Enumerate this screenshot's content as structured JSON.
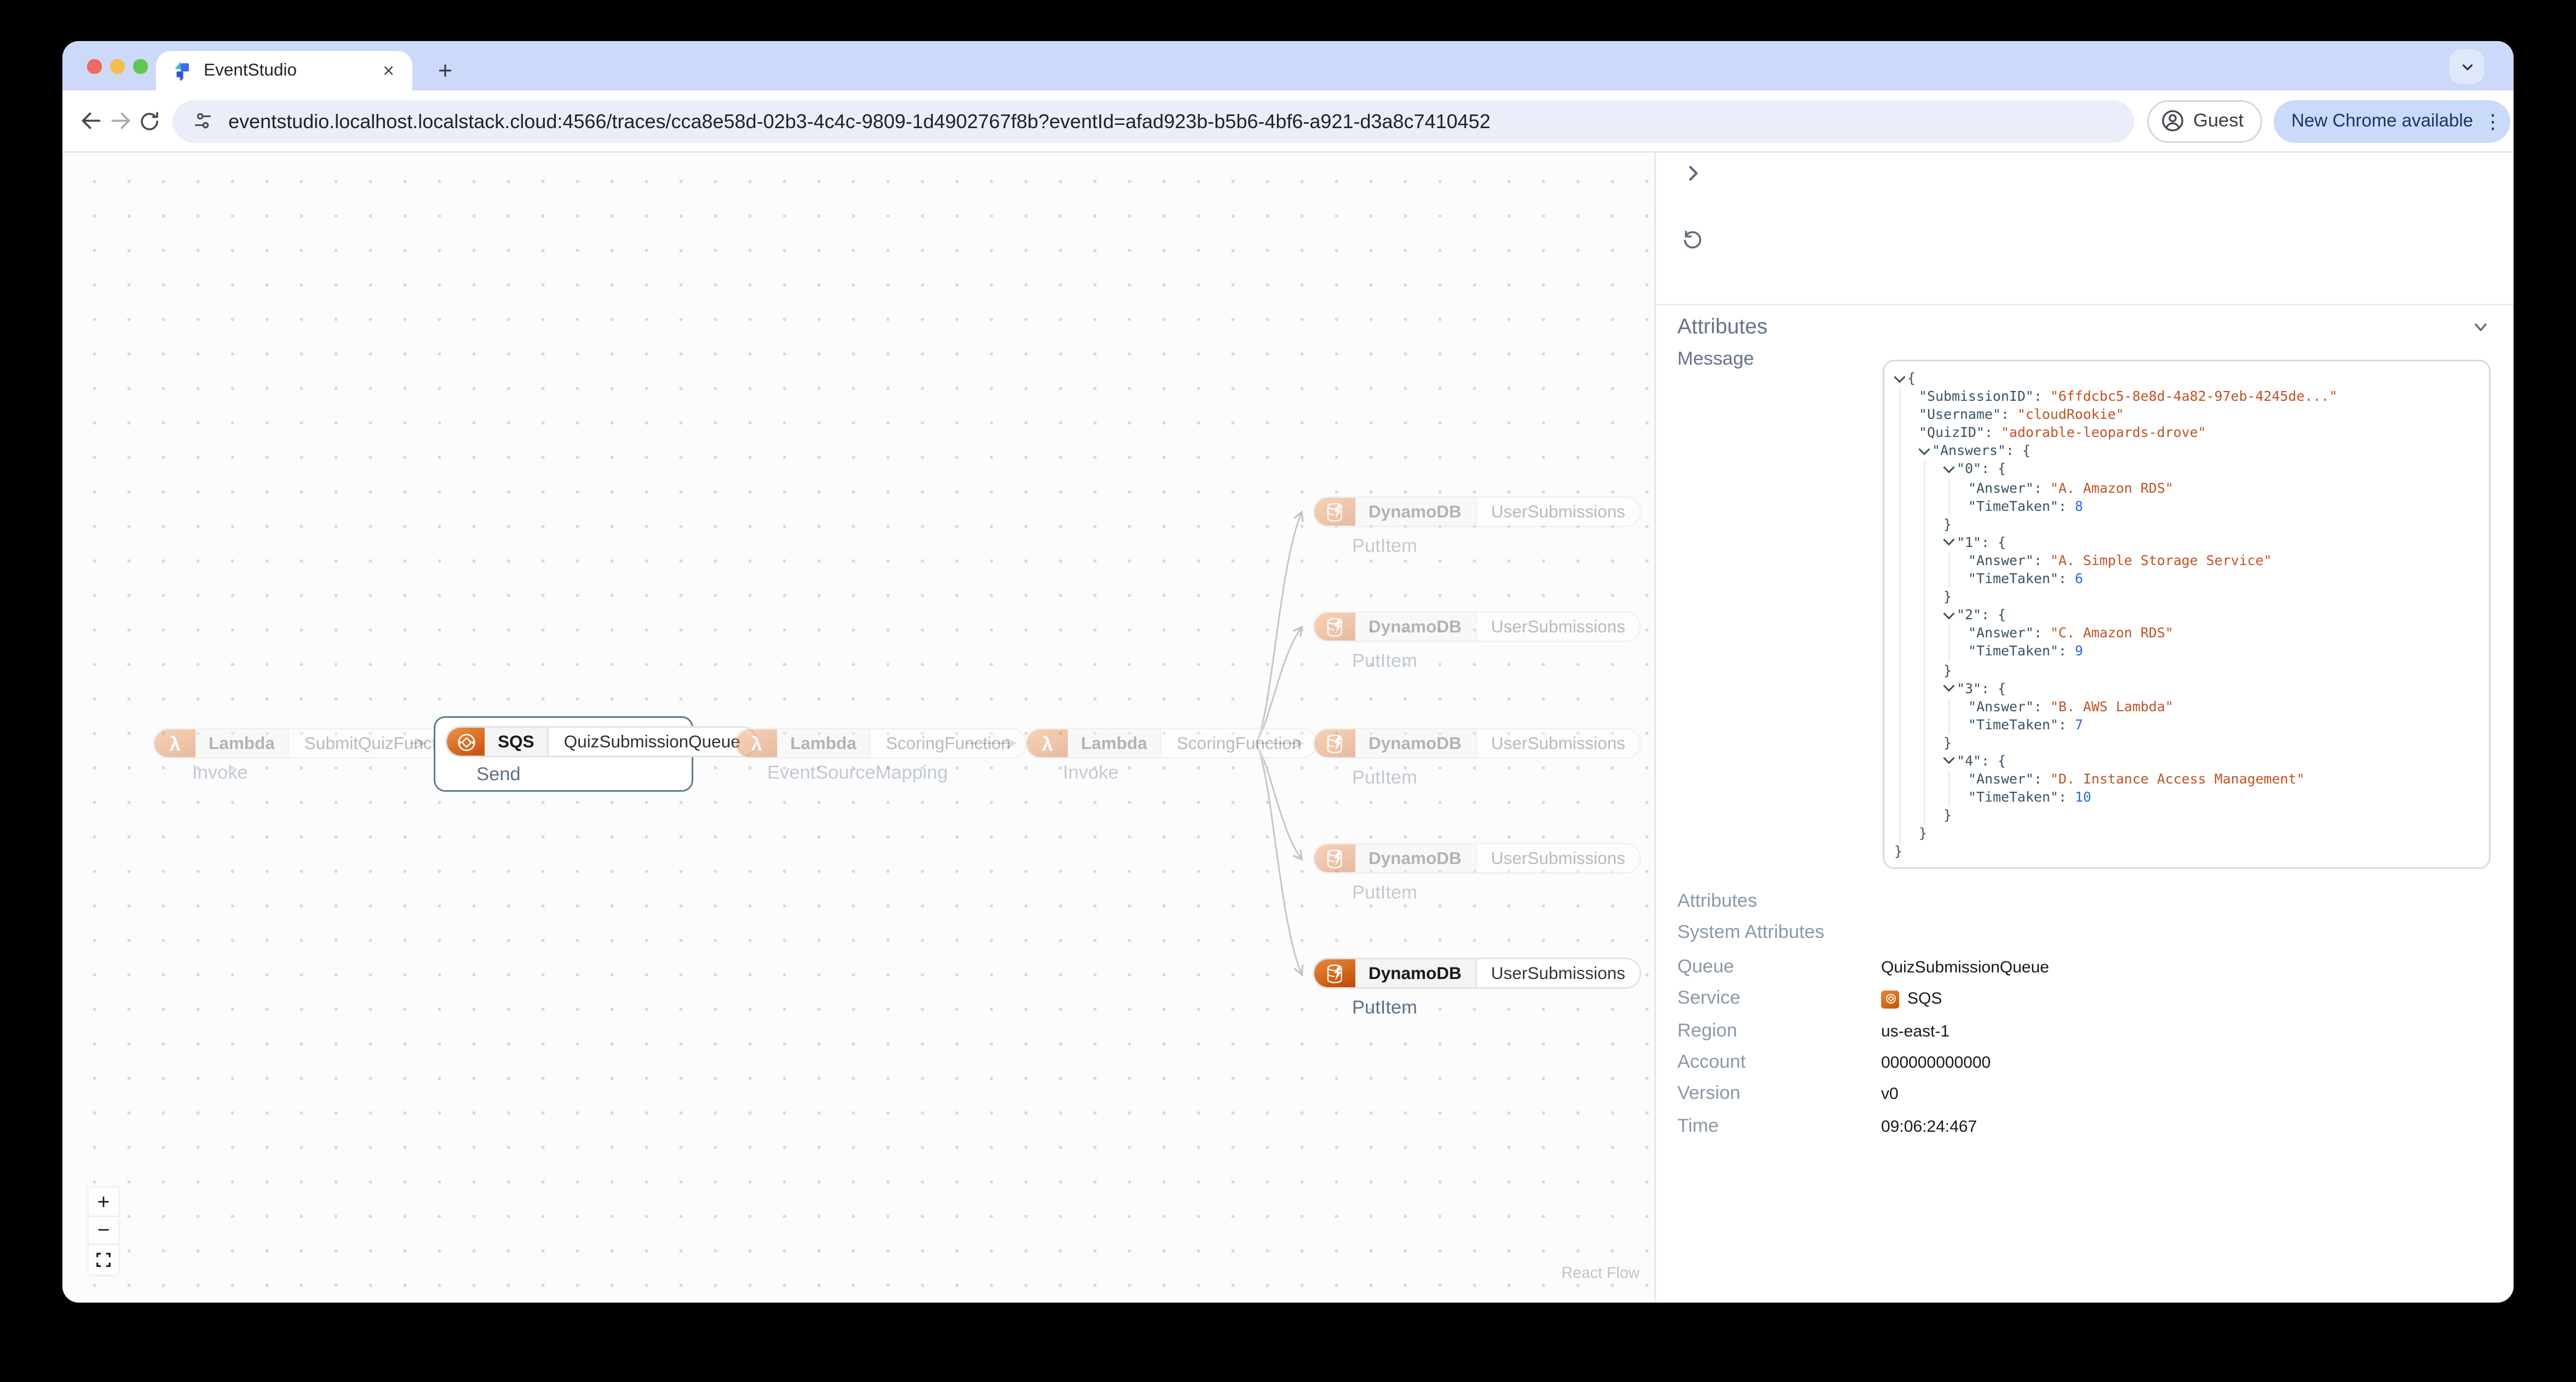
{
  "browser": {
    "tab_title": "EventStudio",
    "url": "eventstudio.localhost.localstack.cloud:4566/traces/cca8e58d-02b3-4c4c-9809-1d4902767f8b?eventId=afad923b-b5b6-4bf6-a921-d3a8c7410452",
    "guest_label": "Guest",
    "update_label": "New Chrome available",
    "new_tab_glyph": "+",
    "close_tab_glyph": "×",
    "kebab_glyph": "⋮"
  },
  "canvas": {
    "nodes": {
      "lambda_submit": {
        "service": "Lambda",
        "name": "SubmitQuizFunction",
        "operation": "Invoke"
      },
      "sqs_queue": {
        "service": "SQS",
        "name": "QuizSubmissionQueue",
        "operation": "Send",
        "selected": true
      },
      "lambda_scoring_esm": {
        "service": "Lambda",
        "name": "ScoringFunction",
        "operation": "EventSourceMapping"
      },
      "lambda_scoring_invoke": {
        "service": "Lambda",
        "name": "ScoringFunction",
        "operation": "Invoke"
      }
    },
    "dynamo_rows": [
      {
        "service": "DynamoDB",
        "name": "UserSubmissions",
        "operation": "PutItem",
        "highlighted": false
      },
      {
        "service": "DynamoDB",
        "name": "UserSubmissions",
        "operation": "PutItem",
        "highlighted": false
      },
      {
        "service": "DynamoDB",
        "name": "UserSubmissions",
        "operation": "PutItem",
        "highlighted": false
      },
      {
        "service": "DynamoDB",
        "name": "UserSubmissions",
        "operation": "PutItem",
        "highlighted": false
      },
      {
        "service": "DynamoDB",
        "name": "UserSubmissions",
        "operation": "PutItem",
        "highlighted": true
      }
    ],
    "controls": {
      "zoom_in": "+",
      "zoom_out": "−",
      "fit_view": "fit-view-icon"
    },
    "attribution": "React Flow"
  },
  "panel": {
    "attributes_header": "Attributes",
    "message_label": "Message",
    "attributes_label": "Attributes",
    "system_attributes_label": "System Attributes",
    "message": {
      "SubmissionID": "6ffdcbc5-8e8d-4a82-97eb-4245de...",
      "Username": "cloudRookie",
      "QuizID": "adorable-leopards-drove",
      "Answers": {
        "0": {
          "Answer": "A. Amazon RDS",
          "TimeTaken": 8
        },
        "1": {
          "Answer": "A. Simple Storage Service",
          "TimeTaken": 6
        },
        "2": {
          "Answer": "C. Amazon RDS",
          "TimeTaken": 9
        },
        "3": {
          "Answer": "B. AWS Lambda",
          "TimeTaken": 7
        },
        "4": {
          "Answer": "D. Instance Access Management",
          "TimeTaken": 10
        }
      }
    },
    "fields": [
      {
        "label": "Queue",
        "value": "QuizSubmissionQueue"
      },
      {
        "label": "Service",
        "value": "SQS",
        "icon": "sqs-icon"
      },
      {
        "label": "Region",
        "value": "us-east-1"
      },
      {
        "label": "Account",
        "value": "000000000000"
      },
      {
        "label": "Version",
        "value": "v0"
      },
      {
        "label": "Time",
        "value": "09:06:24:467"
      }
    ]
  },
  "colors": {
    "tabstrip": "#cdd9f8",
    "update_pill": "#c9dbf9",
    "aws_orange_gradient_start": "#ee9245",
    "aws_orange_gradient_end": "#c8500c",
    "selection_border": "#5e7d8a",
    "json_key": "#3a5263",
    "json_string": "#c05325",
    "json_number": "#2d6bd9",
    "edge": "#bfc3cb"
  }
}
